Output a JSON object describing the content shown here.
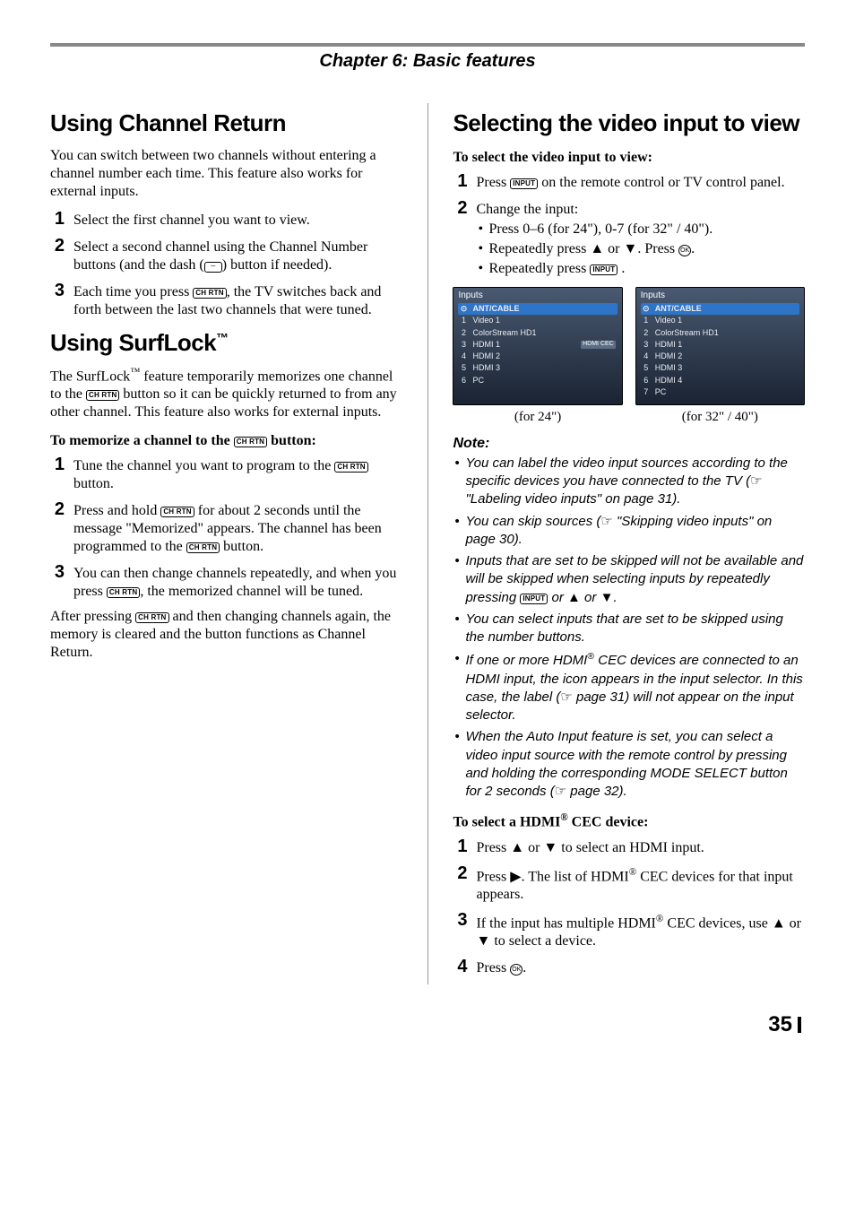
{
  "chapter_header": "Chapter 6: Basic features",
  "left": {
    "s1": {
      "title": "Using Channel Return",
      "intro": "You can switch between two channels without entering a channel number each time. This feature also works for external inputs.",
      "steps": [
        "Select the first channel you want to view.",
        "Select a second channel using the Channel Number buttons (and the dash (",
        "Each time you press "
      ],
      "step2_tail": ") button if needed).",
      "step3_tail": ", the TV switches back and forth between the last two channels that were tuned."
    },
    "s2": {
      "title_pre": "Using SurfLock",
      "tm": "™",
      "intro_a": "The SurfLock",
      "intro_b": " feature temporarily memorizes one channel to the ",
      "intro_c": " button so it can be quickly returned to from any other channel. This feature also works for external inputs.",
      "lead": "To memorize a channel to the ",
      "lead_tail": " button:",
      "steps": {
        "s1a": "Tune the channel you want to program to the ",
        "s1b": " button.",
        "s2a": "Press and hold ",
        "s2b": " for about 2 seconds until the message \"Memorized\" appears. The channel has been programmed to the ",
        "s2c": " button.",
        "s3a": "You can then change channels repeatedly, and when you press ",
        "s3b": ", the memorized channel will be tuned."
      },
      "after_a": "After pressing ",
      "after_b": " and then changing channels again, the memory is cleared and the button functions as Channel Return."
    }
  },
  "right": {
    "title": "Selecting the video input to view",
    "lead1": "To select the video input to view:",
    "steps1": {
      "s1a": "Press ",
      "s1b": " on the remote control or TV control panel.",
      "s2": "Change the input:",
      "b1": "Press 0–6 (for 24\"), 0-7 (for 32\" / 40\").",
      "b2a": "Repeatedly press ",
      "b2b": " or ",
      "b2c": ". Press ",
      "b2d": ".",
      "b3a": "Repeatedly press ",
      "b3b": " ."
    },
    "screens": {
      "title": "Inputs",
      "left": {
        "caption": "(for 24\")",
        "items": [
          {
            "idx": "0",
            "label": "ANT/CABLE",
            "sel": true,
            "ant": true
          },
          {
            "idx": "1",
            "label": "Video 1"
          },
          {
            "idx": "2",
            "label": "ColorStream HD1"
          },
          {
            "idx": "3",
            "label": "HDMI 1",
            "tag": "HDMI CEC"
          },
          {
            "idx": "4",
            "label": "HDMI 2"
          },
          {
            "idx": "5",
            "label": "HDMI 3"
          },
          {
            "idx": "6",
            "label": "PC"
          }
        ]
      },
      "right": {
        "caption": "(for 32\" / 40\")",
        "items": [
          {
            "idx": "0",
            "label": "ANT/CABLE",
            "sel": true,
            "ant": true
          },
          {
            "idx": "1",
            "label": "Video 1"
          },
          {
            "idx": "2",
            "label": "ColorStream HD1"
          },
          {
            "idx": "3",
            "label": "HDMI 1"
          },
          {
            "idx": "4",
            "label": "HDMI 2"
          },
          {
            "idx": "5",
            "label": "HDMI 3"
          },
          {
            "idx": "6",
            "label": "HDMI 4"
          },
          {
            "idx": "7",
            "label": "PC"
          }
        ]
      }
    },
    "note_head": "Note:",
    "notes": {
      "n1a": "You can label the video input sources according to the specific devices you have connected to the TV (",
      "n1b": " \"Labeling video inputs\" on page 31).",
      "n2a": "You can skip sources (",
      "n2b": " \"Skipping video inputs\" on page 30).",
      "n3a": "Inputs that are set to be skipped will not be available and will be skipped when selecting inputs by repeatedly pressing ",
      "n3b": " or ",
      "n3c": " or ",
      "n3d": ".",
      "n4": "You can select inputs that are set to be skipped using the number buttons.",
      "n5a": "If one or more HDMI",
      "n5b": " CEC devices are connected to an HDMI input, the icon appears in the input selector. In this case, the label (",
      "n5c": " page 31) will not appear on the input selector.",
      "n6a": "When the Auto Input feature is set, you can select a video input source with the remote control by pressing and holding the corresponding MODE SELECT button for 2 seconds (",
      "n6b": " page 32)."
    },
    "lead2a": "To select a HDMI",
    "lead2b": " CEC device:",
    "steps2": {
      "s1a": "Press ",
      "s1b": " or ",
      "s1c": " to select an HDMI input.",
      "s2a": "Press ",
      "s2b": ". The list of HDMI",
      "s2c": " CEC devices for that input appears.",
      "s3a": "If the input has multiple HDMI",
      "s3b": " CEC devices, use ",
      "s3c": " or ",
      "s3d": " to select a device.",
      "s4a": "Press ",
      "s4b": "."
    }
  },
  "buttons": {
    "chrtn": "CH RTN",
    "input": "INPUT",
    "ok": "OK",
    "dash": "–"
  },
  "glyphs": {
    "up": "▲",
    "down": "▼",
    "right": "▶",
    "pointer": "☞",
    "reg": "®"
  },
  "page_number": "35"
}
